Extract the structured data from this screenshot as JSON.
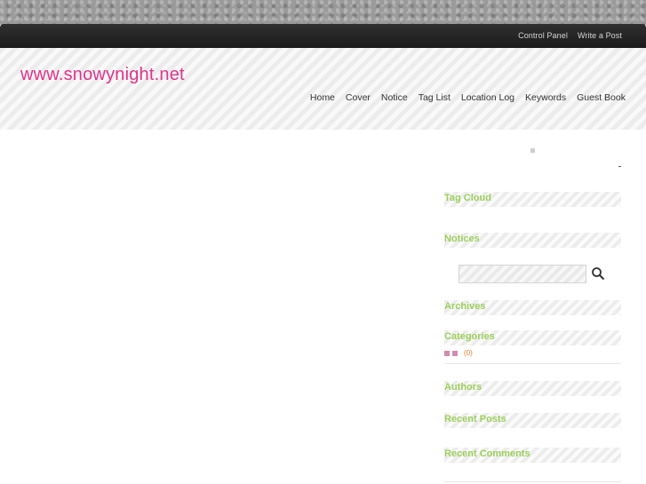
{
  "topbar": {
    "links": [
      "Control Panel",
      "Write a Post"
    ]
  },
  "header": {
    "site_title": "www.snowynight.net",
    "nav": [
      "Home",
      "Cover",
      "Notice",
      "Tag List",
      "Location Log",
      "Keywords",
      "Guest Book"
    ]
  },
  "sidebar": {
    "tag_cloud_title": "Tag Cloud",
    "notices_title": "Notices",
    "search": {
      "placeholder": "",
      "icon": "search-icon"
    },
    "archives_title": "Archives",
    "categories_title": "Categories",
    "categories_count": "(0)",
    "authors_title": "Authors",
    "recent_posts_title": "Recent Posts",
    "recent_comments_title": "Recent Comments"
  },
  "colors": {
    "brand": "#e0348c",
    "widget_title": "#9ccf5a",
    "count_accent": "#e07a2a",
    "topbar": "#222222"
  }
}
